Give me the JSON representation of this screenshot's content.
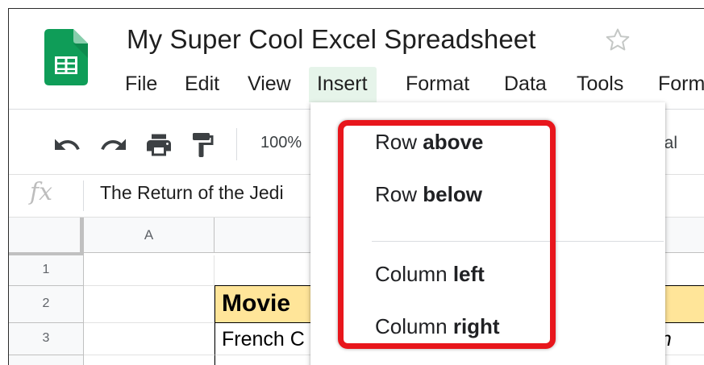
{
  "app": {
    "title": "My Super Cool Excel Spreadsheet",
    "logo_icon": "sheets-logo-icon",
    "brand_color": "#0f9d58"
  },
  "menubar": {
    "items": [
      {
        "label": "File"
      },
      {
        "label": "Edit"
      },
      {
        "label": "View"
      },
      {
        "label": "Insert",
        "active": true
      },
      {
        "label": "Format"
      },
      {
        "label": "Data"
      },
      {
        "label": "Tools"
      },
      {
        "label": "Form"
      }
    ]
  },
  "toolbar": {
    "icons": [
      "undo-icon",
      "redo-icon",
      "print-icon",
      "paint-format-icon"
    ],
    "zoom": "100%",
    "font": "ial"
  },
  "formula_bar": {
    "fx_label": "fx",
    "value": "The Return of the Jedi"
  },
  "grid": {
    "columns": [
      "A"
    ],
    "rows": [
      "1",
      "2",
      "3"
    ],
    "cells": {
      "b2": "Movie",
      "b3": "French C",
      "right3": "rin"
    },
    "header_fill": "#ffe599"
  },
  "insert_menu": {
    "items": [
      {
        "prefix": "Row ",
        "bold": "above"
      },
      {
        "prefix": "Row ",
        "bold": "below"
      },
      {
        "prefix": "Column ",
        "bold": "left"
      },
      {
        "prefix": "Column ",
        "bold": "right"
      }
    ],
    "highlight_color": "#e8161c"
  }
}
